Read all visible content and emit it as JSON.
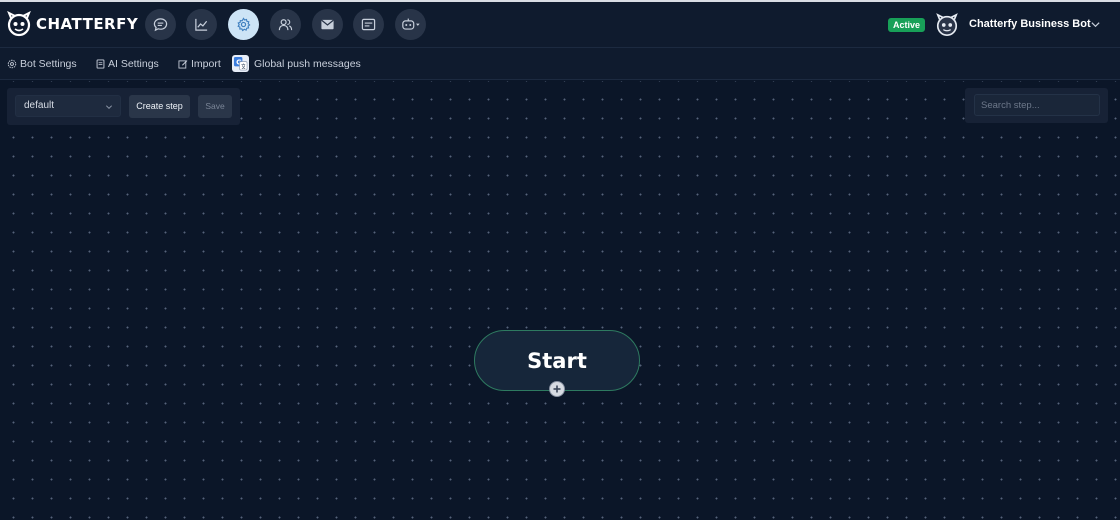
{
  "app": {
    "name": "CHATTERFY"
  },
  "nav": {
    "items": [
      {
        "icon": "chat-bubble-icon",
        "active": false
      },
      {
        "icon": "analytics-chart-icon",
        "active": false
      },
      {
        "icon": "gear-icon",
        "active": true
      },
      {
        "icon": "users-icon",
        "active": false
      },
      {
        "icon": "mail-icon",
        "active": false
      },
      {
        "icon": "message-box-icon",
        "active": false
      },
      {
        "icon": "robot-icon",
        "active": false
      }
    ]
  },
  "status": {
    "label": "Active",
    "color": "#18a058"
  },
  "bot": {
    "name": "Chatterfy Business Bot"
  },
  "subnav": {
    "bot_settings": "Bot Settings",
    "ai_settings": "AI Settings",
    "import": "Import",
    "global_push": "Global push messages"
  },
  "toolbar": {
    "flow_select_value": "default",
    "create_step": "Create step",
    "save": "Save"
  },
  "search": {
    "placeholder": "Search step..."
  },
  "canvas": {
    "start_node_label": "Start"
  },
  "colors": {
    "background": "#0b1628",
    "accent": "#cde4f6",
    "node_border": "#2e7a60"
  }
}
